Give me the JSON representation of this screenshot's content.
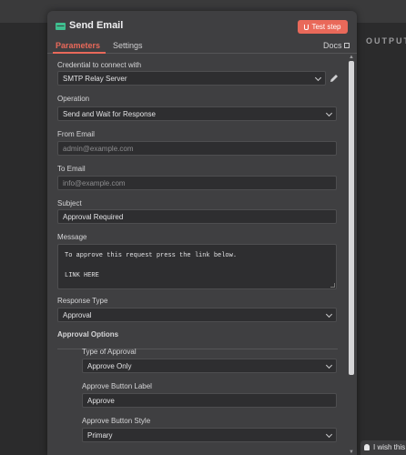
{
  "background": {
    "output_label": "OUTPUT",
    "hint_text": "I wish this"
  },
  "header": {
    "title": "Send Email",
    "icon": "mail-icon",
    "test_button_label": "Test step"
  },
  "tabs": {
    "parameters": "Parameters",
    "settings": "Settings",
    "docs": "Docs"
  },
  "colors": {
    "accent": "#e9695a",
    "icon_green": "#3fbf8f",
    "panel": "#3f3f41",
    "field": "#2e2e30"
  },
  "form": {
    "credential": {
      "label": "Credential to connect with",
      "value": "SMTP Relay Server"
    },
    "operation": {
      "label": "Operation",
      "value": "Send and Wait for Response"
    },
    "from_email": {
      "label": "From Email",
      "placeholder": "admin@example.com"
    },
    "to_email": {
      "label": "To Email",
      "placeholder": "info@example.com"
    },
    "subject": {
      "label": "Subject",
      "value": "Approval Required"
    },
    "message": {
      "label": "Message",
      "lines": [
        "To approve this request press the link below.",
        "",
        "LINK HERE"
      ]
    },
    "response_type": {
      "label": "Response Type",
      "value": "Approval"
    },
    "approval_options": {
      "heading": "Approval Options",
      "type_of_approval": {
        "label": "Type of Approval",
        "value": "Approve Only"
      },
      "approve_button_label": {
        "label": "Approve Button Label",
        "value": "Approve"
      },
      "approve_button_style": {
        "label": "Approve Button Style",
        "value": "Primary"
      }
    }
  }
}
